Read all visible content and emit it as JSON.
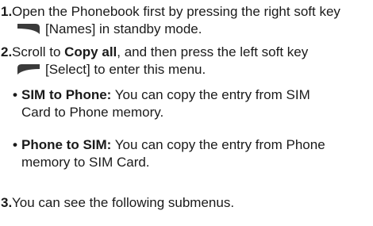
{
  "steps": [
    {
      "number": "1.",
      "text_before": "Open the Phonebook first by pressing the right soft key",
      "key_icon": "right-soft-key-icon",
      "text_after": "[Names] in standby mode."
    },
    {
      "number": "2.",
      "text_before": "Scroll to ",
      "emphasis": "Copy all",
      "text_middle": ", and then press the left soft key",
      "key_icon": "left-soft-key-icon",
      "text_after": "[Select] to enter this menu."
    },
    {
      "number": "3.",
      "text": "You can see the following submenus."
    }
  ],
  "bullets": [
    {
      "marker": "•",
      "term": "SIM to Phone:",
      "line1": " You can copy the entry from SIM",
      "line2": "Card to Phone memory."
    },
    {
      "marker": "•",
      "term": "Phone to SIM:",
      "line1": " You can copy the entry from Phone",
      "line2": "memory to SIM Card."
    }
  ],
  "colors": {
    "text": "#1a1a1a",
    "key_fill": "#3a3a3a"
  }
}
